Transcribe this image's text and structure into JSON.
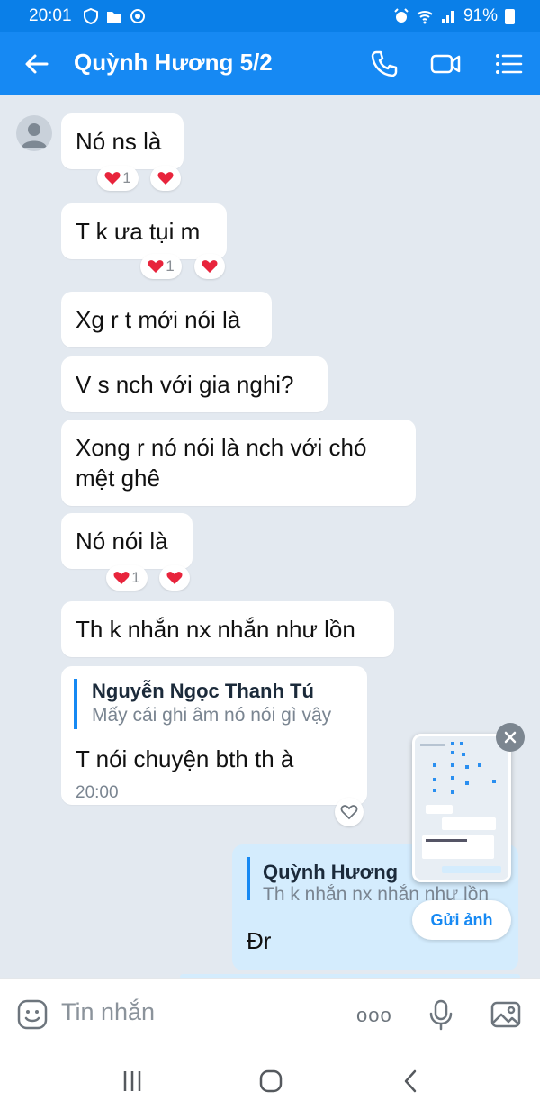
{
  "status_bar": {
    "time": "20:01",
    "battery": "91%"
  },
  "header": {
    "title": "Quỳnh Hương 5/2"
  },
  "messages": [
    {
      "text": "Nó ns là",
      "reaction_count": "1"
    },
    {
      "text": "T k ưa tụi m",
      "reaction_count": "1"
    },
    {
      "text": "Xg r t mới nói là"
    },
    {
      "text": "V s nch với gia nghi?"
    },
    {
      "text_line1": "Xong r nó nói là nch với chó",
      "text_line2": "mệt ghê"
    },
    {
      "text": "Nó nói là",
      "reaction_count": "1"
    },
    {
      "text": "Th k nhắn nx nhắn như lồn"
    }
  ],
  "reply_message": {
    "quote_name": "Nguyễn Ngọc Thanh Tú",
    "quote_text": "Mấy cái ghi âm nó nói gì vậy",
    "text": "T nói chuyện bth th à",
    "time": "20:00"
  },
  "outgoing_message": {
    "quote_name": "Quỳnh Hương",
    "quote_text": "Th k nhắn nx nhắn như lồn",
    "text": "Đr"
  },
  "screenshot_popup": {
    "send_label": "Gửi ảnh"
  },
  "composer": {
    "placeholder": "Tin nhắn",
    "more_label": "ooo"
  },
  "colors": {
    "header": "#1689f3",
    "chat_background": "#e3e9f0",
    "outgoing_bubble": "#d4ecfd",
    "heart": "#e8243c"
  }
}
